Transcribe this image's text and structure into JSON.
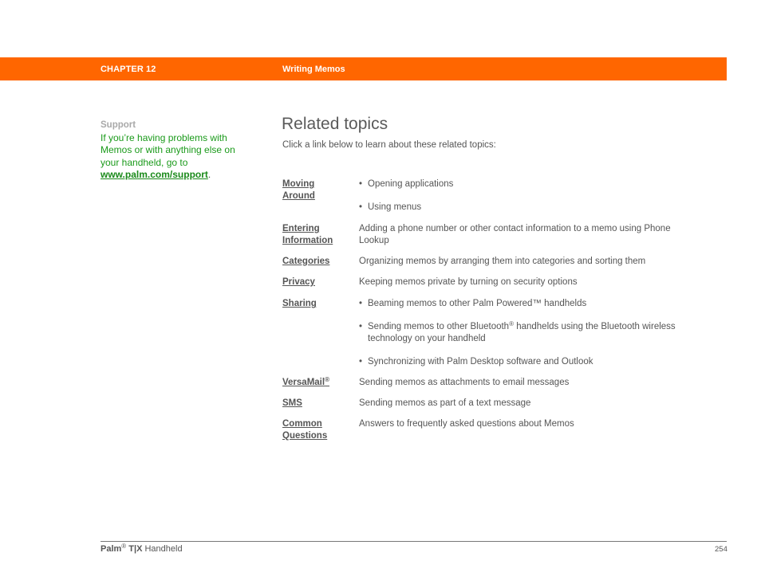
{
  "header": {
    "chapter": "CHAPTER 12",
    "title": "Writing Memos",
    "bar_color": "#ff6600"
  },
  "sidebar": {
    "heading": "Support",
    "text": "If you’re having problems with Memos or with anything else on your handheld, go to ",
    "link": "www.palm.com/support",
    "trailing": ".",
    "text_color": "#1a9a1a"
  },
  "main": {
    "title": "Related topics",
    "intro": "Click a link below to learn about these related topics:",
    "topics": [
      {
        "link_line1": "Moving",
        "link_line2": "Around",
        "bullets": [
          "Opening applications",
          "Using menus"
        ]
      },
      {
        "link_line1": "Entering",
        "link_line2": "Information",
        "desc": "Adding a phone number or other contact information to a memo using Phone Lookup"
      },
      {
        "link": "Categories",
        "desc": "Organizing memos by arranging them into categories and sorting them"
      },
      {
        "link": "Privacy",
        "desc": "Keeping memos private by turning on security options"
      },
      {
        "link": "Sharing",
        "bullets": [
          "Beaming memos to other Palm Powered™ handhelds",
          "Sending memos to other Bluetooth",
          "handhelds using the Bluetooth wireless technology on your handheld",
          "Synchronizing with Palm Desktop software and Outlook"
        ]
      },
      {
        "link": "VersaMail",
        "link_sup": "®",
        "desc": "Sending memos as attachments to email messages"
      },
      {
        "link": "SMS",
        "desc": "Sending memos as part of a text message"
      },
      {
        "link_line1": "Common",
        "link_line2": "Questions",
        "desc": "Answers to frequently asked questions about Memos"
      }
    ],
    "bullet_glyph": "•",
    "reg_mark": "®"
  },
  "footer": {
    "brand": "Palm",
    "reg": "®",
    "model": "T|X",
    "product": "Handheld",
    "page_number": "254"
  }
}
